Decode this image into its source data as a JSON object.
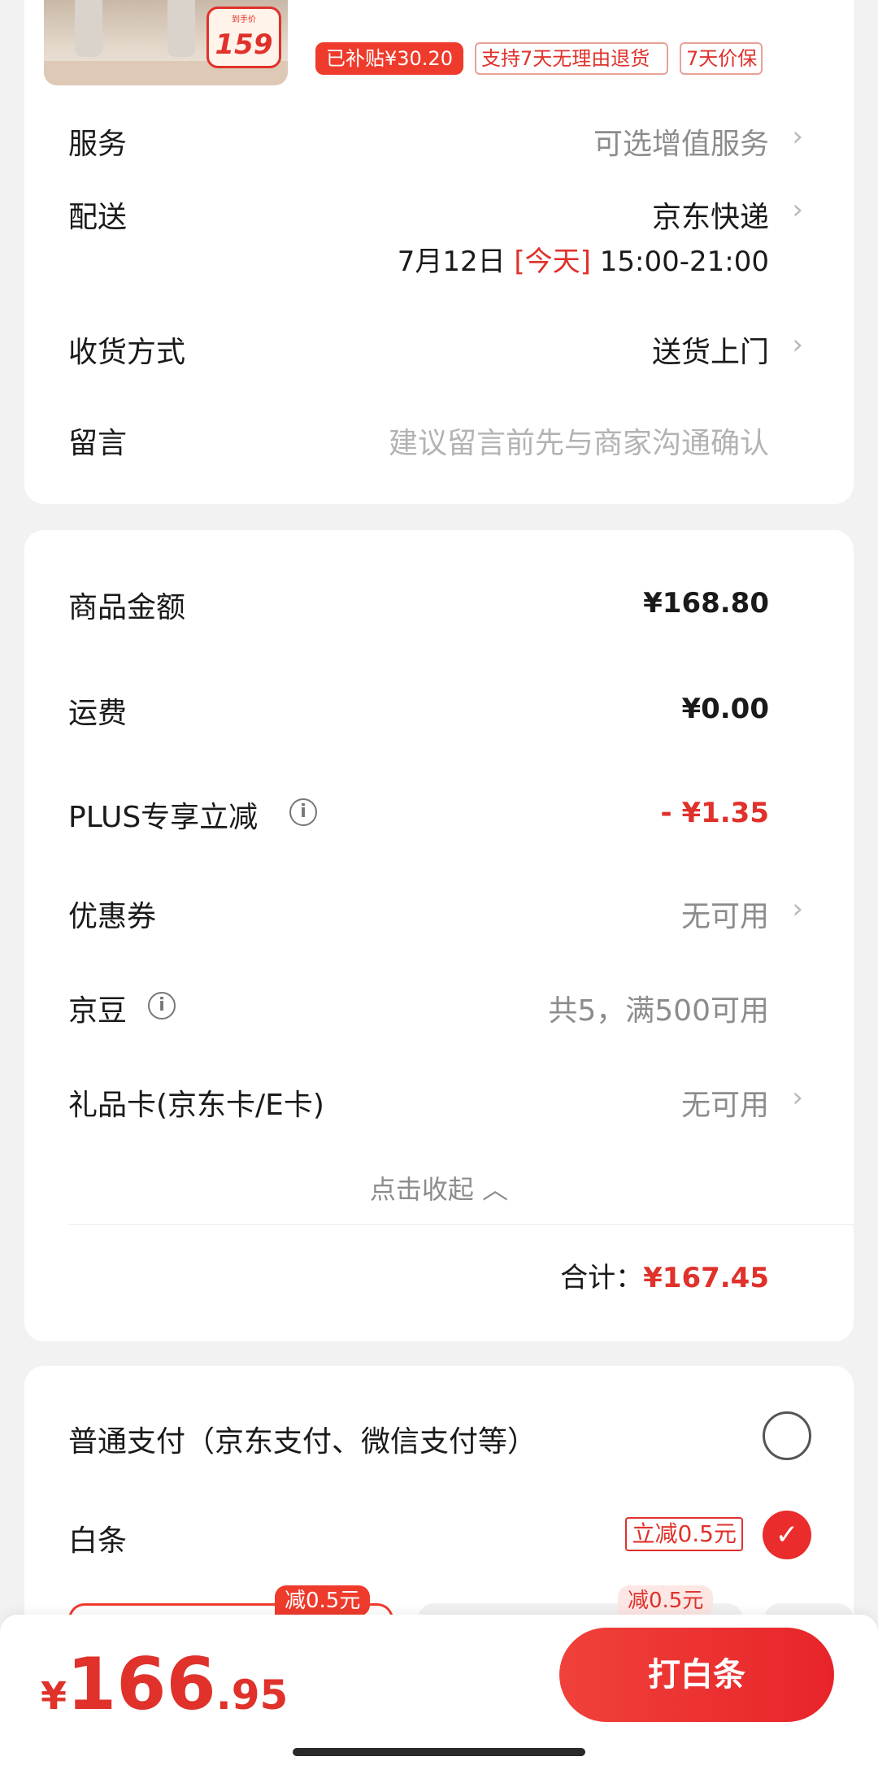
{
  "product": {
    "price_tag": "159",
    "price_tag_caption": "到手价",
    "tags": [
      "已补贴¥30.20",
      "支持7天无理由退货",
      "7天价保"
    ]
  },
  "order": {
    "service_label": "服务",
    "service_value": "可选增值服务",
    "delivery_label": "配送",
    "delivery_value": "京东快递",
    "delivery_date": "7月12日",
    "delivery_today": "[今天]",
    "delivery_time": "15:00-21:00",
    "receive_label": "收货方式",
    "receive_value": "送货上门",
    "message_label": "留言",
    "message_placeholder": "建议留言前先与商家沟通确认"
  },
  "summary": {
    "goods_label": "商品金额",
    "goods_value": "¥168.80",
    "freight_label": "运费",
    "freight_value": "¥0.00",
    "plus_label": "PLUS专享立减",
    "plus_value": "- ¥1.35",
    "coupon_label": "优惠券",
    "coupon_value": "无可用",
    "jingdou_label": "京豆",
    "jingdou_value": "共5，满500可用",
    "giftcard_label": "礼品卡(京东卡/E卡)",
    "giftcard_value": "无可用",
    "collapse_label": "点击收起 ︿",
    "total_label": "合计：",
    "total_value": "¥167.45"
  },
  "payment": {
    "normal_label": "普通支付（京东支付、微信支付等）",
    "baitiao_label": "白条",
    "baitiao_promo": "立减0.5元",
    "plan_badge_1": "减0.5元",
    "plan_badge_2": "减0.5元"
  },
  "bottom": {
    "currency": "¥",
    "amount_int": "166",
    "amount_dec": ".95",
    "pay_button": "打白条"
  },
  "colors": {
    "accent_red": "#e0312b",
    "button_red": "#ea2c2c",
    "background": "#f2f2f2"
  },
  "icons": {
    "chevron": "chevron-right-icon",
    "info": "info-icon",
    "check": "check-icon"
  }
}
